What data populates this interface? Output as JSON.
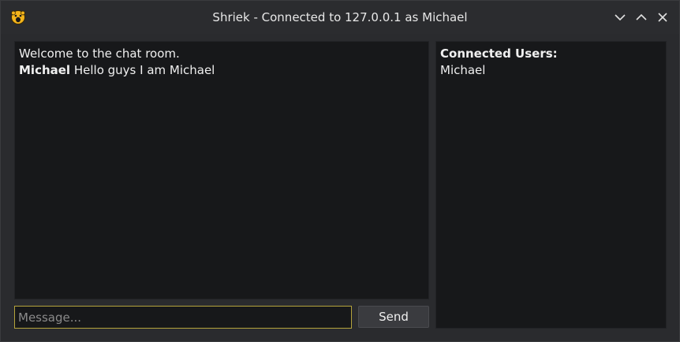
{
  "window": {
    "title": "Shriek - Connected to 127.0.0.1 as Michael",
    "icon": "shriek-face-icon",
    "controls": [
      "minimize-icon",
      "maximize-icon",
      "close-icon"
    ]
  },
  "chat": {
    "welcome": "Welcome to the chat room.",
    "messages": [
      {
        "author": "Michael",
        "text": "Hello guys I am Michael"
      }
    ]
  },
  "users": {
    "heading": "Connected Users:",
    "list": [
      "Michael"
    ]
  },
  "composer": {
    "placeholder": "Message...",
    "value": "",
    "send_label": "Send"
  },
  "colors": {
    "background": "#2a2b2e",
    "pane": "#17181a",
    "input_focus": "#b5a33c",
    "icon_yellow": "#f3b41b"
  }
}
